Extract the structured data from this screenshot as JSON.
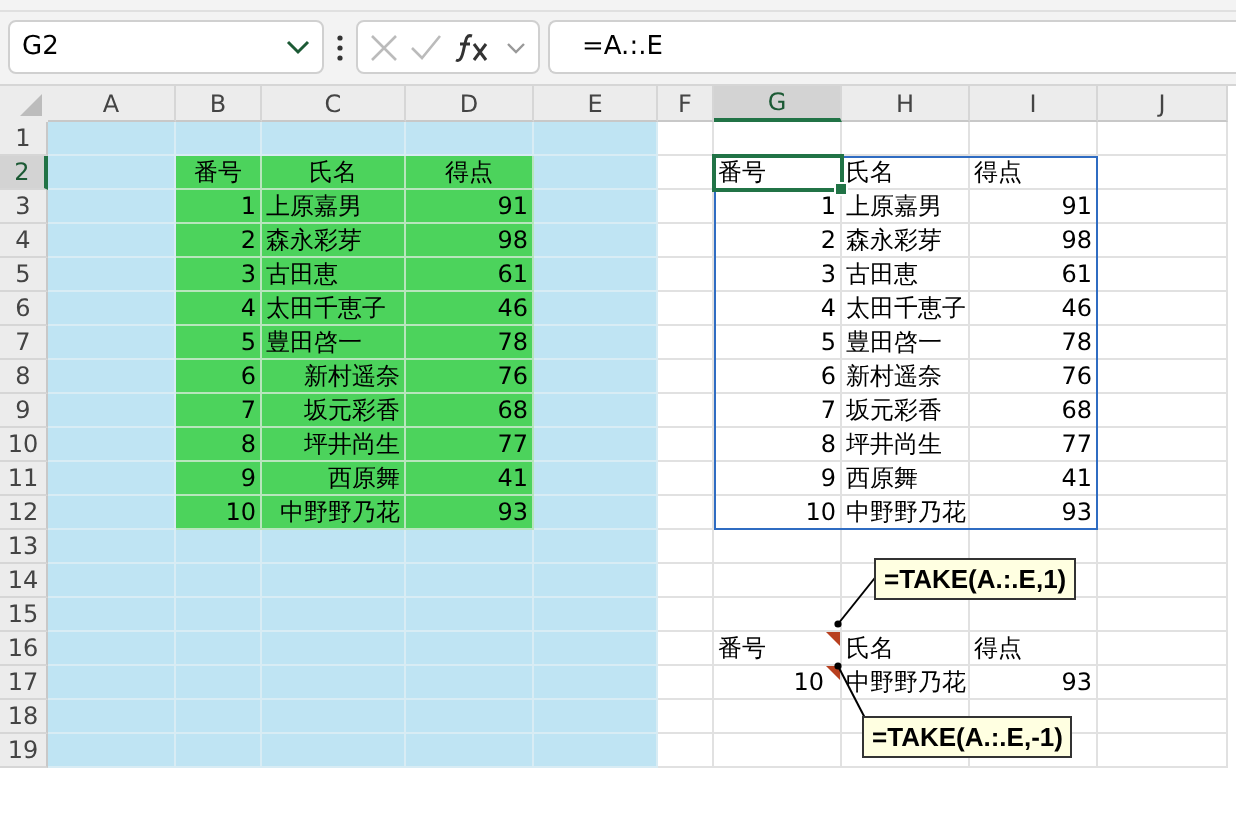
{
  "name_box": {
    "value": "G2"
  },
  "formula_bar": {
    "value": "=A.:.E"
  },
  "columns": [
    {
      "label": "A",
      "selected": false
    },
    {
      "label": "B",
      "selected": false
    },
    {
      "label": "C",
      "selected": false
    },
    {
      "label": "D",
      "selected": false
    },
    {
      "label": "E",
      "selected": false
    },
    {
      "label": "F",
      "selected": false
    },
    {
      "label": "G",
      "selected": true
    },
    {
      "label": "H",
      "selected": false
    },
    {
      "label": "I",
      "selected": false
    },
    {
      "label": "J",
      "selected": false
    }
  ],
  "rows": [
    {
      "label": "1",
      "selected": false,
      "cells": [
        null,
        null,
        null,
        null,
        null,
        null,
        null,
        null,
        null,
        null
      ]
    },
    {
      "label": "2",
      "selected": true,
      "cells": [
        null,
        {
          "text": "番号",
          "kind": "heading"
        },
        {
          "text": "氏名",
          "kind": "heading"
        },
        {
          "text": "得点",
          "kind": "heading"
        },
        null,
        null,
        {
          "text": "番号",
          "kind": "text"
        },
        {
          "text": "氏名",
          "kind": "text"
        },
        {
          "text": "得点",
          "kind": "text"
        },
        null
      ]
    },
    {
      "label": "3",
      "selected": false,
      "cells": [
        null,
        {
          "text": "1",
          "kind": "number"
        },
        {
          "text": "上原嘉男",
          "kind": "text"
        },
        {
          "text": "91",
          "kind": "number"
        },
        null,
        null,
        {
          "text": "1",
          "kind": "number"
        },
        {
          "text": "上原嘉男",
          "kind": "text"
        },
        {
          "text": "91",
          "kind": "number"
        },
        null
      ]
    },
    {
      "label": "4",
      "selected": false,
      "cells": [
        null,
        {
          "text": "2",
          "kind": "number"
        },
        {
          "text": "森永彩芽",
          "kind": "text"
        },
        {
          "text": "98",
          "kind": "number"
        },
        null,
        null,
        {
          "text": "2",
          "kind": "number"
        },
        {
          "text": "森永彩芽",
          "kind": "text"
        },
        {
          "text": "98",
          "kind": "number"
        },
        null
      ]
    },
    {
      "label": "5",
      "selected": false,
      "cells": [
        null,
        {
          "text": "3",
          "kind": "number"
        },
        {
          "text": "古田恵",
          "kind": "text"
        },
        {
          "text": "61",
          "kind": "number"
        },
        null,
        null,
        {
          "text": "3",
          "kind": "number"
        },
        {
          "text": "古田恵",
          "kind": "text"
        },
        {
          "text": "61",
          "kind": "number"
        },
        null
      ]
    },
    {
      "label": "6",
      "selected": false,
      "cells": [
        null,
        {
          "text": "4",
          "kind": "number"
        },
        {
          "text": "太田千恵子",
          "kind": "text"
        },
        {
          "text": "46",
          "kind": "number"
        },
        null,
        null,
        {
          "text": "4",
          "kind": "number"
        },
        {
          "text": "太田千恵子",
          "kind": "text"
        },
        {
          "text": "46",
          "kind": "number"
        },
        null
      ]
    },
    {
      "label": "7",
      "selected": false,
      "cells": [
        null,
        {
          "text": "5",
          "kind": "number"
        },
        {
          "text": "豊田啓一",
          "kind": "text"
        },
        {
          "text": "78",
          "kind": "number"
        },
        null,
        null,
        {
          "text": "5",
          "kind": "number"
        },
        {
          "text": "豊田啓一",
          "kind": "text"
        },
        {
          "text": "78",
          "kind": "number"
        },
        null
      ]
    },
    {
      "label": "8",
      "selected": false,
      "cells": [
        null,
        {
          "text": "6",
          "kind": "number"
        },
        {
          "text": "新村遥奈",
          "kind": "indented"
        },
        {
          "text": "76",
          "kind": "number"
        },
        null,
        null,
        {
          "text": "6",
          "kind": "number"
        },
        {
          "text": "新村遥奈",
          "kind": "text"
        },
        {
          "text": "76",
          "kind": "number"
        },
        null
      ]
    },
    {
      "label": "9",
      "selected": false,
      "cells": [
        null,
        {
          "text": "7",
          "kind": "number"
        },
        {
          "text": "坂元彩香",
          "kind": "indented"
        },
        {
          "text": "68",
          "kind": "number"
        },
        null,
        null,
        {
          "text": "7",
          "kind": "number"
        },
        {
          "text": "坂元彩香",
          "kind": "text"
        },
        {
          "text": "68",
          "kind": "number"
        },
        null
      ]
    },
    {
      "label": "10",
      "selected": false,
      "cells": [
        null,
        {
          "text": "8",
          "kind": "number"
        },
        {
          "text": "坪井尚生",
          "kind": "indented"
        },
        {
          "text": "77",
          "kind": "number"
        },
        null,
        null,
        {
          "text": "8",
          "kind": "number"
        },
        {
          "text": "坪井尚生",
          "kind": "text"
        },
        {
          "text": "77",
          "kind": "number"
        },
        null
      ]
    },
    {
      "label": "11",
      "selected": false,
      "cells": [
        null,
        {
          "text": "9",
          "kind": "number"
        },
        {
          "text": "西原舞",
          "kind": "indented"
        },
        {
          "text": "41",
          "kind": "number"
        },
        null,
        null,
        {
          "text": "9",
          "kind": "number"
        },
        {
          "text": "西原舞",
          "kind": "text"
        },
        {
          "text": "41",
          "kind": "number"
        },
        null
      ]
    },
    {
      "label": "12",
      "selected": false,
      "cells": [
        null,
        {
          "text": "10",
          "kind": "number"
        },
        {
          "text": "中野野乃花",
          "kind": "indented"
        },
        {
          "text": "93",
          "kind": "number"
        },
        null,
        null,
        {
          "text": "10",
          "kind": "number"
        },
        {
          "text": "中野野乃花",
          "kind": "text"
        },
        {
          "text": "93",
          "kind": "number"
        },
        null
      ]
    },
    {
      "label": "13",
      "selected": false,
      "cells": [
        null,
        null,
        null,
        null,
        null,
        null,
        null,
        null,
        null,
        null
      ]
    },
    {
      "label": "14",
      "selected": false,
      "cells": [
        null,
        null,
        null,
        null,
        null,
        null,
        null,
        null,
        null,
        null
      ]
    },
    {
      "label": "15",
      "selected": false,
      "cells": [
        null,
        null,
        null,
        null,
        null,
        null,
        null,
        null,
        null,
        null
      ]
    },
    {
      "label": "16",
      "selected": false,
      "cells": [
        null,
        null,
        null,
        null,
        null,
        null,
        {
          "text": "番号",
          "kind": "text",
          "note": {
            "text": "=TAKE(A.:.E,1)",
            "kind": "above"
          }
        },
        {
          "text": "氏名",
          "kind": "text"
        },
        {
          "text": "得点",
          "kind": "text"
        },
        null
      ]
    },
    {
      "label": "17",
      "selected": false,
      "cells": [
        null,
        null,
        null,
        null,
        null,
        null,
        {
          "text": "10",
          "kind": "number",
          "note": {
            "text": "=TAKE(A.:.E,-1)",
            "kind": "below"
          }
        },
        {
          "text": "中野野乃花",
          "kind": "text"
        },
        {
          "text": "93",
          "kind": "number"
        },
        null
      ]
    },
    {
      "label": "18",
      "selected": false,
      "cells": [
        null,
        null,
        null,
        null,
        null,
        null,
        null,
        null,
        null,
        null
      ]
    },
    {
      "label": "19",
      "selected": false,
      "cells": [
        null,
        null,
        null,
        null,
        null,
        null,
        null,
        null,
        null,
        null
      ]
    }
  ]
}
